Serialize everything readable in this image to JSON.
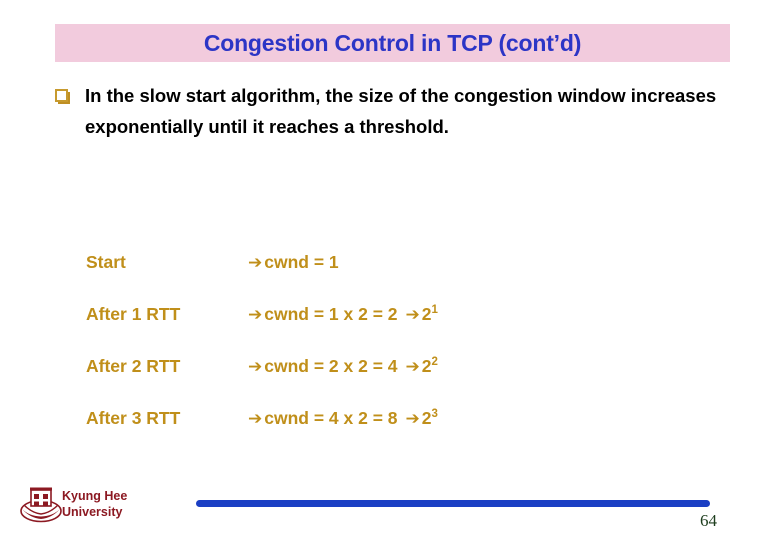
{
  "slide": {
    "title": "Congestion Control in TCP (cont’d)",
    "title_band_color": "#f2cbdd",
    "title_text_color": "#2c35c6",
    "body_text_color": "#000000",
    "accent_color": "#c08f1a",
    "bullet_icon": "hollow-square-bullet",
    "bullet_text": "In the slow start algorithm,  the size of the congestion window increases exponentially until it reaches a threshold."
  },
  "steps": {
    "rows": [
      {
        "label": "Start",
        "arrow": "➔",
        "value": "cwnd = 1",
        "has_power": false,
        "arrow2": "",
        "base": "",
        "exponent": ""
      },
      {
        "label": "After 1 RTT",
        "arrow": "➔",
        "value": "cwnd = 1 x 2 = 2",
        "has_power": true,
        "arrow2": "➔",
        "base": "2",
        "exponent": "1"
      },
      {
        "label": "After 2 RTT",
        "arrow": "➔",
        "value": "cwnd = 2 x 2 = 4",
        "has_power": true,
        "arrow2": "➔",
        "base": "2",
        "exponent": "2"
      },
      {
        "label": "After 3 RTT",
        "arrow": "➔",
        "value": "cwnd = 4 x 2 = 8",
        "has_power": true,
        "arrow2": "➔",
        "base": "2",
        "exponent": "3"
      }
    ]
  },
  "footer": {
    "logo_icon": "kyung-hee-university-crest",
    "organization_line1": "Kyung Hee",
    "organization_line2": "University",
    "organization_color": "#8c1922",
    "bar_color": "#1b3fc4",
    "page_number": "64",
    "page_number_color": "#1d3d1d"
  }
}
